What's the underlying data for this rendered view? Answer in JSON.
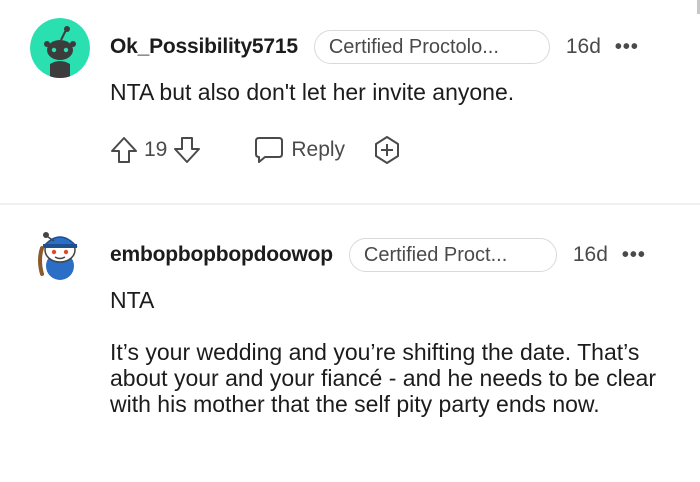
{
  "comments": [
    {
      "username": "Ok_Possibility5715",
      "flair": "Certified Proctolo...",
      "time": "16d",
      "more": "•••",
      "body": [
        "NTA but also don't let her invite anyone."
      ],
      "score": "19",
      "reply_label": "Reply"
    },
    {
      "username": "embopbopbopdoowop",
      "flair": "Certified Proct...",
      "time": "16d",
      "more": "•••",
      "body": [
        "NTA",
        "It’s your wedding and you’re shifting the date. That’s about your and your fiancé - and he needs to be clear with his mother that the self pity party ends now."
      ]
    }
  ],
  "colors": {
    "avatar1_bg": "#2ae0b0",
    "snoo_blue": "#2a6ec5",
    "meta_gray": "#4a4a4a",
    "divider": "#edeff1"
  }
}
